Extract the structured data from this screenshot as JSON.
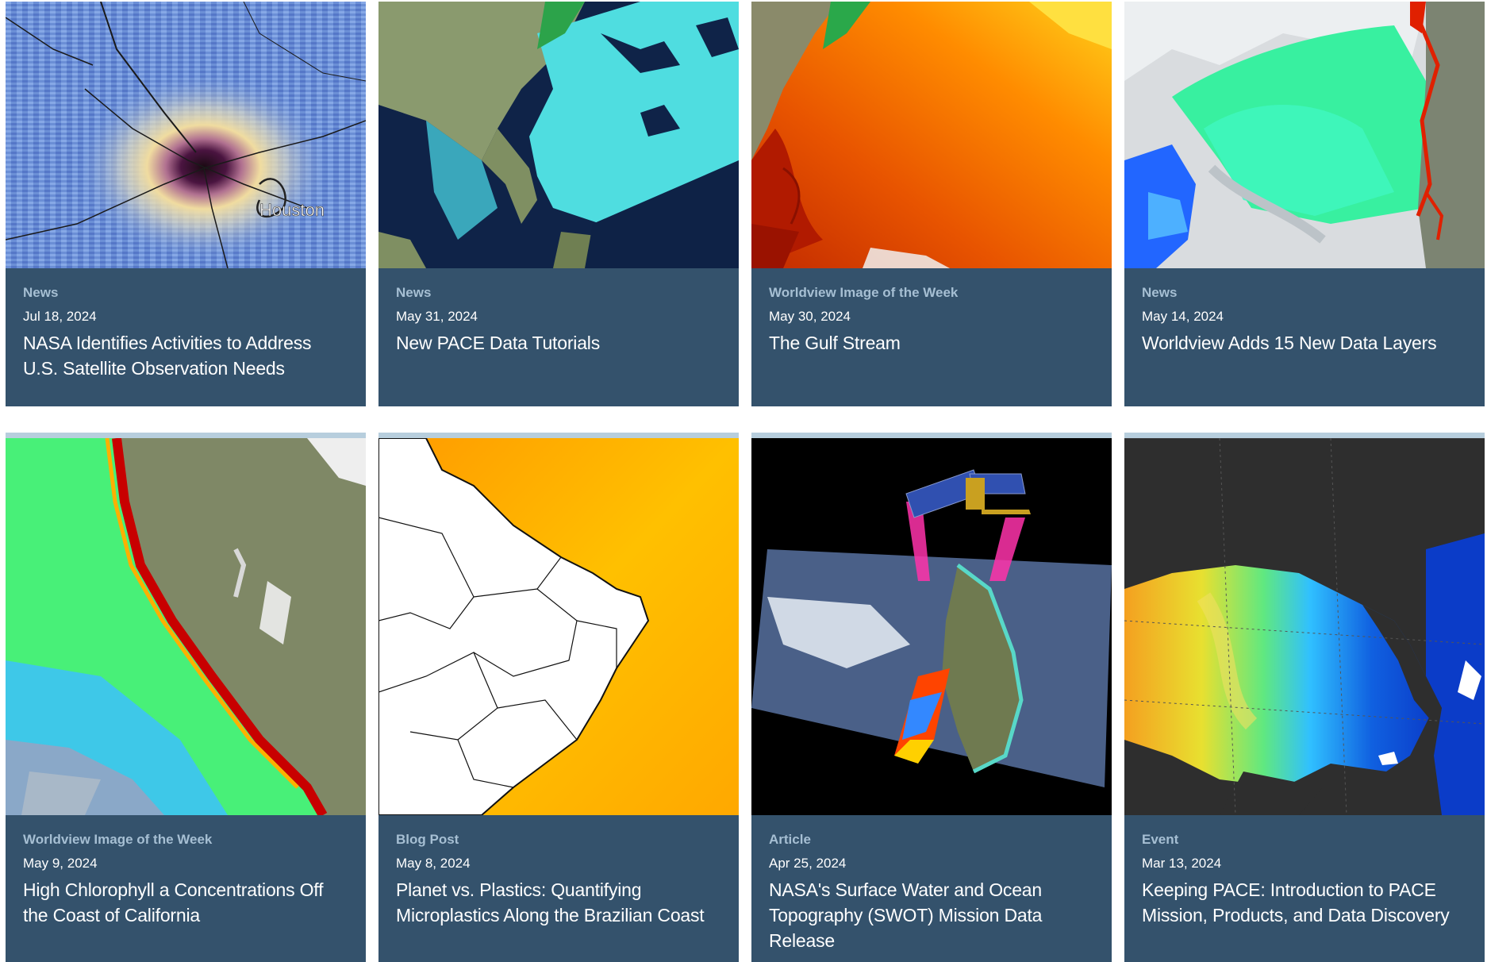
{
  "cards": [
    {
      "kind": "News",
      "date": "Jul 18, 2024",
      "title": "NASA Identifies Activities to Address U.S. Satellite Observation Needs",
      "image_label": "Houston"
    },
    {
      "kind": "News",
      "date": "May 31, 2024",
      "title": "New PACE Data Tutorials"
    },
    {
      "kind": "Worldview Image of the Week",
      "date": "May 30, 2024",
      "title": "The Gulf Stream"
    },
    {
      "kind": "News",
      "date": "May 14, 2024",
      "title": "Worldview Adds 15 New Data Layers"
    },
    {
      "kind": "Worldview Image of the Week",
      "date": "May 9, 2024",
      "title": "High Chlorophyll a Concentrations Off the Coast of California"
    },
    {
      "kind": "Blog Post",
      "date": "May 8, 2024",
      "title": "Planet vs. Plastics: Quantifying Microplastics Along the Brazilian Coast"
    },
    {
      "kind": "Article",
      "date": "Apr 25, 2024",
      "title": "NASA's Surface Water and Ocean Topography (SWOT) Mission Data Release"
    },
    {
      "kind": "Event",
      "date": "Mar 13, 2024",
      "title": "Keeping PACE: Introduction to PACE Mission, Products, and Data Discovery"
    }
  ],
  "colors": {
    "card_bg": "#34526c",
    "kind_text": "#a6bfd3",
    "row2_border": "#b7cedd"
  }
}
